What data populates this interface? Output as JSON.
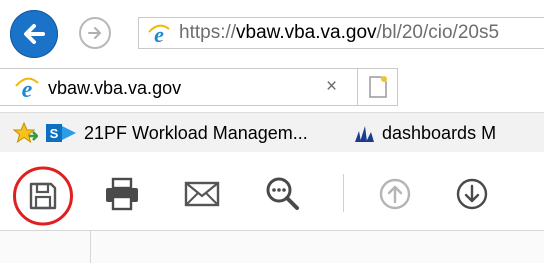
{
  "browser": {
    "url": {
      "prefix": "https://",
      "domain": "vbaw.vba.va.gov",
      "path": "/bl/20/cio/20s5"
    },
    "tab": {
      "title": "vbaw.vba.va.gov",
      "close_glyph": "×"
    },
    "favorites": [
      {
        "label": "21PF Workload Managem...",
        "icon": "sharepoint-icon"
      },
      {
        "label": "dashboards M",
        "icon": "dynamics-icon"
      }
    ]
  },
  "toolbar": {
    "tools": [
      {
        "name": "save",
        "icon": "save-icon",
        "highlighted": true
      },
      {
        "name": "print",
        "icon": "print-icon"
      },
      {
        "name": "email",
        "icon": "email-icon"
      },
      {
        "name": "find",
        "icon": "search-icon"
      },
      {
        "name": "previous page",
        "icon": "arrow-up-icon",
        "enabled": false
      },
      {
        "name": "next page",
        "icon": "arrow-down-icon",
        "enabled": true
      }
    ]
  },
  "colors": {
    "back_button": "#1a73c8",
    "highlight_circle": "#e01f1f",
    "ie_blue": "#1e88d6"
  }
}
